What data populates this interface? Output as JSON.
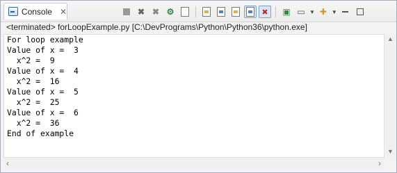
{
  "tab": {
    "label": "Console",
    "close_glyph": "✕",
    "icon": "console-icon"
  },
  "toolbar": {
    "icons": [
      "terminate-icon",
      "remove-launch-icon",
      "remove-all-terminated-icon",
      "debug-icon",
      "copy-icon",
      "clear-console-icon",
      "scroll-lock-icon",
      "word-wrap-icon",
      "show-on-stdout-icon",
      "show-on-stderr-icon",
      "pin-console-icon",
      "display-selected-console-icon",
      "open-console-icon",
      "view-menu-icon"
    ]
  },
  "status": {
    "text": "<terminated> forLoopExample.py [C:\\DevPrograms\\Python\\Python36\\python.exe]"
  },
  "output": {
    "lines": [
      "For loop example",
      "Value of x =  3",
      "  x^2 =  9",
      "Value of x =  4",
      "  x^2 =  16",
      "Value of x =  5",
      "  x^2 =  25",
      "Value of x =  6",
      "  x^2 =  36",
      "End of example"
    ]
  },
  "scroll": {
    "up": "▲",
    "down": "▼",
    "left": "‹",
    "right": "›"
  }
}
